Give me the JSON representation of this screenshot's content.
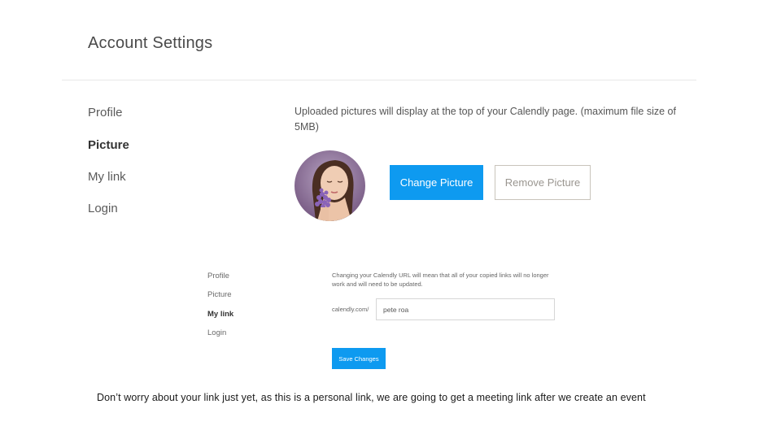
{
  "header": {
    "title": "Account Settings"
  },
  "sidebar": {
    "items": [
      {
        "label": "Profile"
      },
      {
        "label": "Picture",
        "active": true
      },
      {
        "label": "My link"
      },
      {
        "label": "Login"
      }
    ]
  },
  "picture_section": {
    "info_text": "Uploaded pictures will display at the top of your Calendly page. (maximum file size of 5MB)",
    "change_button": "Change Picture",
    "remove_button": "Remove Picture"
  },
  "link_screenshot": {
    "sidebar": {
      "items": [
        {
          "label": "Profile"
        },
        {
          "label": "Picture"
        },
        {
          "label": "My link",
          "active": true
        },
        {
          "label": "Login"
        }
      ]
    },
    "info_text": "Changing your Calendly URL will mean that all of your copied links will no longer work and will need to be updated.",
    "url_prefix": "calendly.com/",
    "url_value": "pete roa",
    "save_button": "Save Changes"
  },
  "caption": "Don’t worry about your link just yet, as this is a personal link, we are going to get a meeting link after we create an event",
  "colors": {
    "accent": "#0e9af0",
    "border": "#c9c4bb"
  }
}
